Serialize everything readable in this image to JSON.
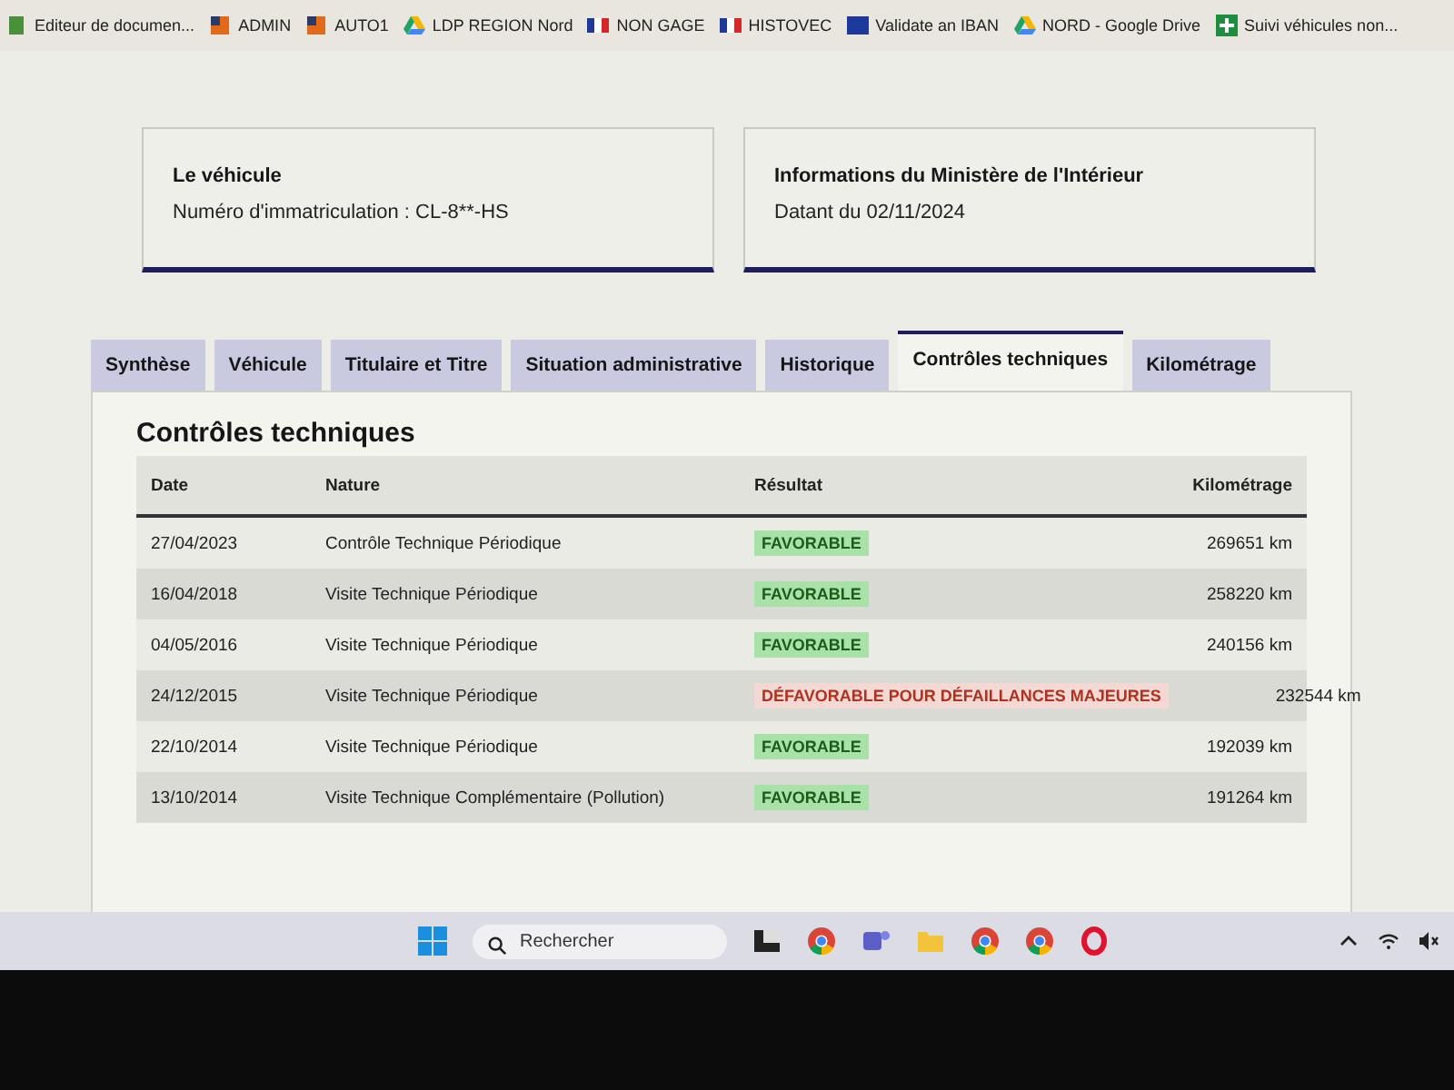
{
  "bookmarks": [
    {
      "kind": "doc",
      "label": "Editeur de documen..."
    },
    {
      "kind": "square",
      "label": "ADMIN"
    },
    {
      "kind": "square",
      "label": "AUTO1"
    },
    {
      "kind": "drive",
      "label": "LDP REGION Nord"
    },
    {
      "kind": "flag",
      "label": "NON GAGE"
    },
    {
      "kind": "flag",
      "label": "HISTOVEC"
    },
    {
      "kind": "iban",
      "label": "Validate an IBAN"
    },
    {
      "kind": "drive",
      "label": "NORD - Google Drive"
    },
    {
      "kind": "sheet",
      "label": "Suivi véhicules non..."
    }
  ],
  "cards": [
    {
      "title": "Le véhicule",
      "text": "Numéro d'immatriculation : CL-8**-HS"
    },
    {
      "title": "Informations du Ministère de l'Intérieur",
      "text": "Datant du 02/11/2024"
    }
  ],
  "tabs": [
    {
      "label": "Synthèse",
      "selected": false
    },
    {
      "label": "Véhicule",
      "selected": false
    },
    {
      "label": "Titulaire et Titre",
      "selected": false
    },
    {
      "label": "Situation administrative",
      "selected": false
    },
    {
      "label": "Historique",
      "selected": false
    },
    {
      "label": "Contrôles techniques",
      "selected": true
    },
    {
      "label": "Kilométrage",
      "selected": false
    }
  ],
  "section_title": "Contrôles techniques",
  "table": {
    "columns": [
      "Date",
      "Nature",
      "Résultat",
      "Kilométrage"
    ],
    "rows": [
      {
        "date": "27/04/2023",
        "nature": "Contrôle Technique Périodique",
        "result": {
          "kind": "favorable",
          "label": "FAVORABLE"
        },
        "km": "269651 km"
      },
      {
        "date": "16/04/2018",
        "nature": "Visite Technique Périodique",
        "result": {
          "kind": "favorable",
          "label": "FAVORABLE"
        },
        "km": "258220 km"
      },
      {
        "date": "04/05/2016",
        "nature": "Visite Technique Périodique",
        "result": {
          "kind": "favorable",
          "label": "FAVORABLE"
        },
        "km": "240156 km"
      },
      {
        "date": "24/12/2015",
        "nature": "Visite Technique Périodique",
        "result": {
          "kind": "unfavorable",
          "label": "DÉFAVORABLE POUR DÉFAILLANCES MAJEURES"
        },
        "km": "232544 km"
      },
      {
        "date": "22/10/2014",
        "nature": "Visite Technique Périodique",
        "result": {
          "kind": "favorable",
          "label": "FAVORABLE"
        },
        "km": "192039 km"
      },
      {
        "date": "13/10/2014",
        "nature": "Visite Technique Complémentaire (Pollution)",
        "result": {
          "kind": "favorable",
          "label": "FAVORABLE"
        },
        "km": "191264 km"
      }
    ]
  },
  "taskbar": {
    "search": {
      "placeholder": "Rechercher"
    }
  }
}
